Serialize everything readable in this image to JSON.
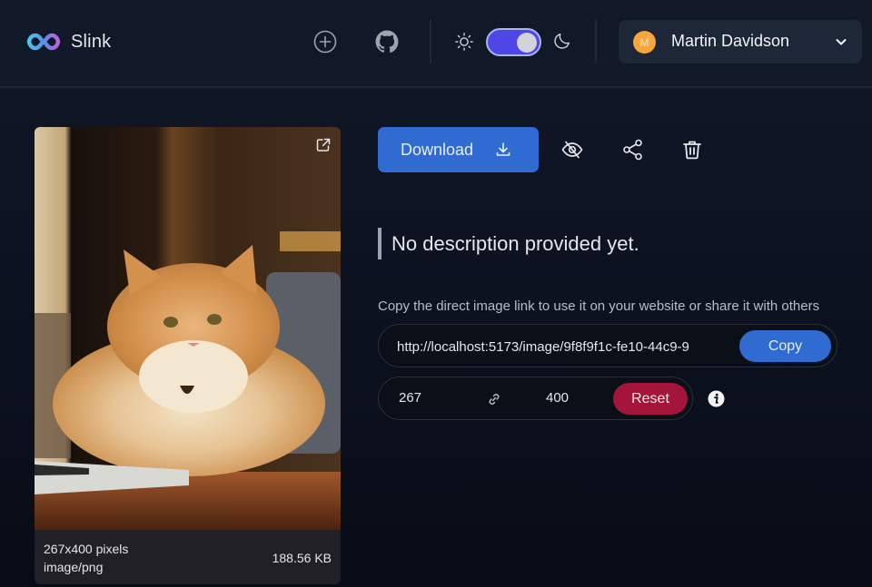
{
  "header": {
    "app_name": "Slink",
    "icons": {
      "upload": "plus-circle-icon",
      "github": "github-icon",
      "light_mode": "sun-icon",
      "dark_mode": "moon-icon"
    },
    "theme_toggle": {
      "state": "dark",
      "on": true
    },
    "user": {
      "initial": "M",
      "name": "Martin Davidson",
      "avatar_color": "#f6a63a"
    }
  },
  "image": {
    "alt": "Fluffy orange cat sitting at a desk next to a laptop",
    "dimensions": "267x400 pixels",
    "mime_type": "image/png",
    "file_size": "188.56 KB"
  },
  "actions": {
    "download_label": "Download",
    "icons": [
      "eye-off-icon",
      "share-icon",
      "trash-icon"
    ]
  },
  "description": "No description provided yet.",
  "share": {
    "hint": "Copy the direct image link to use it on your website or share it with others",
    "url": "http://localhost:5173/image/9f8f9f1c-fe10-44c9-9",
    "copy_label": "Copy"
  },
  "resize": {
    "width": "267",
    "height": "400",
    "reset_label": "Reset"
  },
  "colors": {
    "primary": "#2f6bd0",
    "danger": "#a3153a",
    "toggle": "#4f46e5",
    "background": "#111827"
  }
}
